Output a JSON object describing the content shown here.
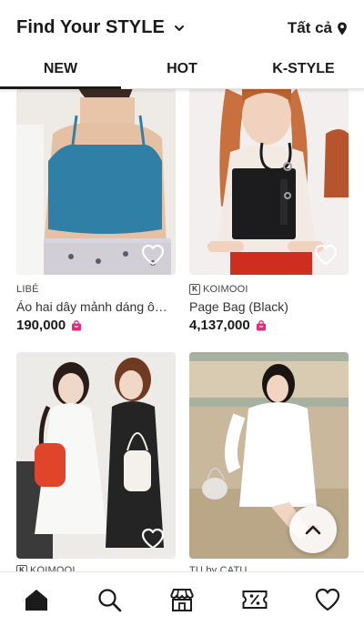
{
  "header": {
    "title": "Find Your STYLE",
    "region_label": "Tất cả"
  },
  "tabs": [
    {
      "label": "NEW",
      "active": true
    },
    {
      "label": "HOT",
      "active": false
    },
    {
      "label": "K-STYLE",
      "active": false
    }
  ],
  "products": [
    {
      "brand": "LIBÉ",
      "brand_badge": "",
      "name": "Áo hai dây mảnh dáng ôm n...",
      "price": "190,000"
    },
    {
      "brand": "KOIMOOI",
      "brand_badge": "K",
      "name": "Page Bag (Black)",
      "price": "4,137,000"
    },
    {
      "brand": "KOIMOOI",
      "brand_badge": "K",
      "name": "",
      "price": ""
    },
    {
      "brand": "TU by CATU",
      "brand_badge": "",
      "name": "",
      "price": ""
    }
  ],
  "colors": {
    "accent_pink": "#e8297a",
    "text_dark": "#1a1a1a"
  },
  "icons": {
    "nav": [
      "home-icon",
      "search-icon",
      "store-icon",
      "coupon-icon",
      "heart-icon"
    ],
    "scroll_top": "chevron-up-icon"
  }
}
